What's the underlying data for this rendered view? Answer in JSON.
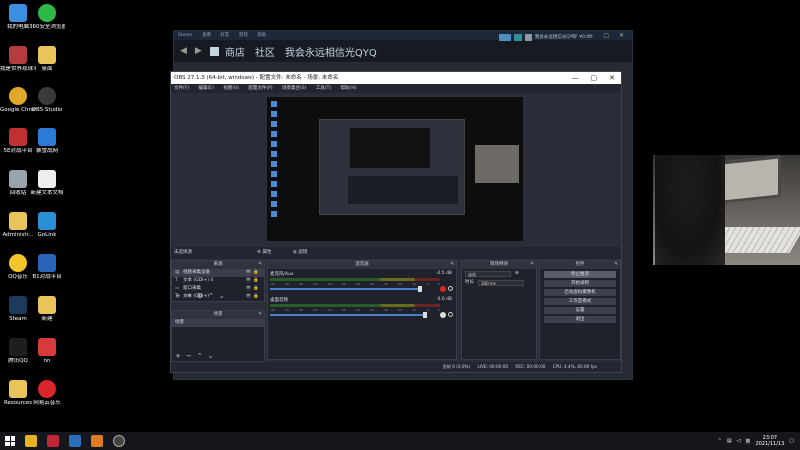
{
  "desktop_icons": [
    {
      "id": "mypc",
      "label": "我的电脑",
      "color": "#3b8fe0"
    },
    {
      "id": "360",
      "label": "360安全浏览器",
      "color": "#2fb84a"
    },
    {
      "id": "game",
      "label": "我是世界观球平台",
      "color": "#b43c3c"
    },
    {
      "id": "desk",
      "label": "桌面",
      "color": "#e8c45a"
    },
    {
      "id": "chrome",
      "label": "Google Chrome",
      "color": "#e0a82a"
    },
    {
      "id": "obs",
      "label": "OBS Studio",
      "color": "#3a3a3a"
    },
    {
      "id": "5e",
      "label": "5E对战平台",
      "color": "#c03030"
    },
    {
      "id": "steam2",
      "label": "暴雪战网",
      "color": "#2c7ad8"
    },
    {
      "id": "recycle",
      "label": "回收站",
      "color": "#9aa4ae"
    },
    {
      "id": "newtxt",
      "label": "新建文本文档",
      "color": "#eeeeee"
    },
    {
      "id": "admin",
      "label": "Administr...",
      "color": "#e8c45a"
    },
    {
      "id": "golink",
      "label": "GoLink",
      "color": "#2b8fd8"
    },
    {
      "id": "qq",
      "label": "QQ音乐",
      "color": "#f2c62a"
    },
    {
      "id": "b1",
      "label": "B1对战平台",
      "color": "#2a64b8"
    },
    {
      "id": "steam",
      "label": "Steam",
      "color": "#1b3a5c"
    },
    {
      "id": "news",
      "label": "新建",
      "color": "#e8c45a"
    },
    {
      "id": "tencent",
      "label": "腾讯QQ",
      "color": "#1e1e1e"
    },
    {
      "id": "nn",
      "label": "nn",
      "color": "#d63a3a"
    },
    {
      "id": "resources",
      "label": "Resources",
      "color": "#e8c45a"
    },
    {
      "id": "netease",
      "label": "网易云音乐",
      "color": "#d8262a"
    }
  ],
  "steam": {
    "topbar": [
      "Steam",
      "查看",
      "好友",
      "游戏",
      "帮助"
    ],
    "nav": [
      "商店",
      "社区",
      "我会永远相信光QYQ"
    ],
    "username": "我会永远相信光QYQ",
    "balance": "¥0.00"
  },
  "obs": {
    "title": "OBS 27.1.3 (64-bit, windows) - 配置文件: 未命名 - 场景: 未命名",
    "menu": [
      "文件(F)",
      "编辑(E)",
      "视图(V)",
      "配置文件(P)",
      "场景集合(S)",
      "工具(T)",
      "帮助(H)"
    ],
    "scene_label": "未选择源",
    "scene_btns": [
      "属性",
      "滤镜"
    ],
    "panels": {
      "sources": "来源",
      "mixer": "混音器",
      "transitions": "转场特效",
      "controls": "控件",
      "scenes": "场景"
    },
    "sources": [
      {
        "icon": "▤",
        "name": "视频采集设备",
        "selected": true
      },
      {
        "icon": "T",
        "name": "文本 (GDI+) 4",
        "selected": false
      },
      {
        "icon": "▭",
        "name": "窗口采集",
        "selected": false
      },
      {
        "icon": "T",
        "name": "文本 (GDI+)",
        "selected": false
      }
    ],
    "scenes": [
      "场景"
    ],
    "mixer": [
      {
        "name": "麦克风/Aux",
        "db": "-2.5 dB",
        "muted": true,
        "level": 0.9
      },
      {
        "name": "桌面音频",
        "db": "0.0 dB",
        "muted": false,
        "level": 0.95
      }
    ],
    "mixer_ticks": [
      "-60",
      "-55",
      "-50",
      "-45",
      "-40",
      "-35",
      "-30",
      "-25",
      "-20",
      "-15",
      "-10",
      "-5",
      "0"
    ],
    "transition": {
      "type": "淡化",
      "duration_label": "时长",
      "duration": "300 ms"
    },
    "controls": [
      "停止推流",
      "开始录制",
      "启动虚拟摄像机",
      "工作室模式",
      "设置",
      "退出"
    ],
    "status": {
      "drop": "丢帧 0 (0.0%)",
      "live": "LIVE: 00:00:00",
      "rec": "REC: 00:00:00",
      "cpu": "CPU: 4.4%, 60.00 fps"
    }
  },
  "taskbar": {
    "icons": [
      "store-icon",
      "game-icon",
      "steam-icon",
      "app-icon",
      "obs-icon"
    ],
    "tray_text": "英",
    "time": "23:07",
    "date": "2021/11/13"
  }
}
